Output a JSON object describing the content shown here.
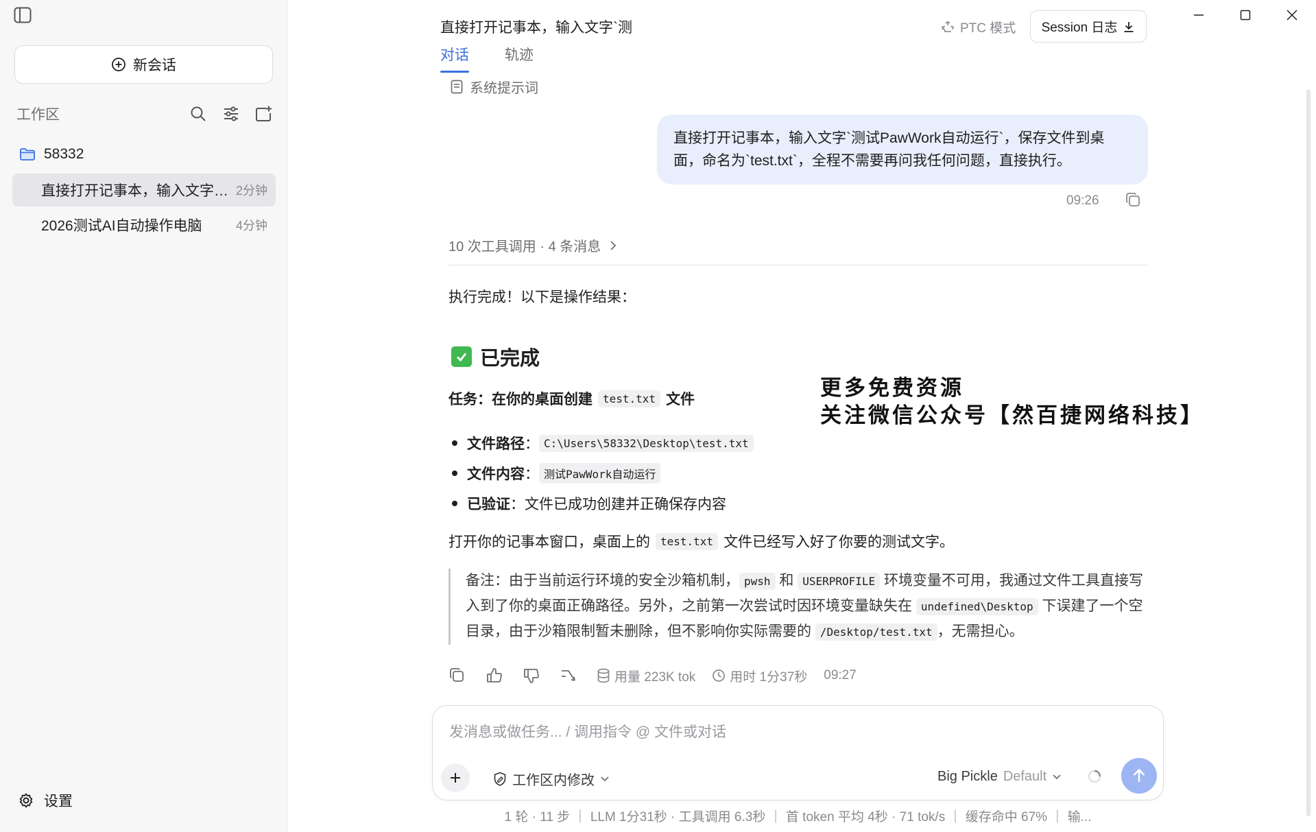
{
  "sidebar": {
    "new_chat": "新会话",
    "workspace_title": "工作区",
    "folder": "58332",
    "sessions": [
      {
        "title": "直接打开记事本，输入文字`...",
        "time": "2分钟"
      },
      {
        "title": "2026测试AI自动操作电脑",
        "time": "4分钟"
      }
    ],
    "settings": "设置"
  },
  "header": {
    "title": "直接打开记事本，输入文字`测",
    "tabs": [
      "对话",
      "轨迹"
    ],
    "ptc_mode": "PTC 模式",
    "session_log": "Session 日志"
  },
  "conversation": {
    "system_prompt": "系统提示词",
    "user_message": "直接打开记事本，输入文字`测试PawWork自动运行`，保存文件到桌面，命名为`test.txt`，全程不需要再问我任何问题，直接执行。",
    "user_time": "09:26",
    "tool_summary": "10 次工具调用 · 4 条消息",
    "reply_intro": "执行完成！以下是操作结果：",
    "done_heading": "已完成",
    "task_prefix": "任务：在你的桌面创建",
    "task_code": "test.txt",
    "task_suffix": "文件",
    "bullets": [
      {
        "label": "文件路径",
        "sep": "：",
        "code": "C:\\Users\\58332\\Desktop\\test.txt",
        "text": ""
      },
      {
        "label": "文件内容",
        "sep": "：",
        "code": "测试PawWork自动运行",
        "text": ""
      },
      {
        "label": "已验证",
        "sep": "：",
        "code": "",
        "text": "文件已成功创建并正确保存内容"
      }
    ],
    "after_prefix": "打开你的记事本窗口，桌面上的",
    "after_code": "test.txt",
    "after_suffix": "文件已经写入好了你要的测试文字。",
    "note": {
      "p1": "备注：由于当前运行环境的安全沙箱机制，",
      "c1": "pwsh",
      "p2": "和",
      "c2": "USERPROFILE",
      "p3": "环境变量不可用，我通过文件工具直接写入到了你的桌面正确路径。另外，之前第一次尝试时因环境变量缺失在",
      "c3": "undefined\\Desktop",
      "p4": "下误建了一个空目录，由于沙箱限制暂未删除，但不影响你实际需要的",
      "c4": "/Desktop/test.txt",
      "p5": "，无需担心。"
    },
    "usage": "用量 223K tok",
    "duration": "用时 1分37秒",
    "reply_time": "09:27"
  },
  "watermark": {
    "line1": "更多免费资源",
    "line2": "关注微信公众号【然百捷网络科技】"
  },
  "composer": {
    "placeholder": "发消息或做任务... / 调用指令 @ 文件或对话",
    "scope": "工作区内修改",
    "model": "Big Pickle",
    "model_variant": "Default"
  },
  "stats": "1 轮 · 11 步 ｜ LLM 1分31秒 · 工具调用 6.3秒 ｜ 首 token 平均 4秒 · 71 tok/s ｜ 缓存命中 67% ｜ 输...",
  "colors": {
    "accent": "#3a6fe0",
    "user_bubble": "#e9eefc",
    "send_button": "#9db6f3",
    "check": "#3fb950"
  }
}
